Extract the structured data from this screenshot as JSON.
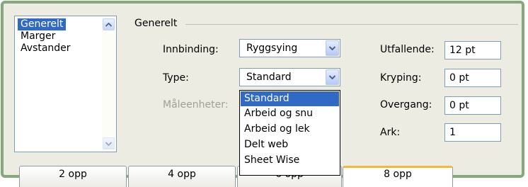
{
  "colors": {
    "accent": "#316ac5",
    "frame": "#84a97a",
    "tab_highlight": "#f8b739"
  },
  "sidebar": {
    "items": [
      {
        "label": "Generelt",
        "selected": true
      },
      {
        "label": "Marger",
        "selected": false
      },
      {
        "label": "Avstander",
        "selected": false
      }
    ],
    "scroll_up_icon": "arrow-up-icon",
    "scroll_down_icon": "arrow-down-icon"
  },
  "group": {
    "title": "Generelt"
  },
  "fields": {
    "innbinding": {
      "label": "Innbinding:",
      "value": "Ryggsying"
    },
    "type": {
      "label": "Type:",
      "value": "Standard"
    },
    "maaleenheter": {
      "label": "Måleenheter:",
      "disabled": true
    },
    "utfallende": {
      "label": "Utfallende:",
      "value": "12 pt"
    },
    "kryping": {
      "label": "Kryping:",
      "value": "0 pt"
    },
    "overgang": {
      "label": "Overgang:",
      "value": "0 pt"
    },
    "ark": {
      "label": "Ark:",
      "value": "1"
    }
  },
  "type_dropdown": {
    "options": [
      "Standard",
      "Arbeid og snu",
      "Arbeid og lek",
      "Delt web",
      "Sheet Wise"
    ],
    "selected": "Standard"
  },
  "tabs": [
    {
      "label": "2 opp",
      "active": false
    },
    {
      "label": "4 opp",
      "active": false
    },
    {
      "label": "6 opp",
      "active": false
    },
    {
      "label": "8 opp",
      "active": true
    }
  ]
}
